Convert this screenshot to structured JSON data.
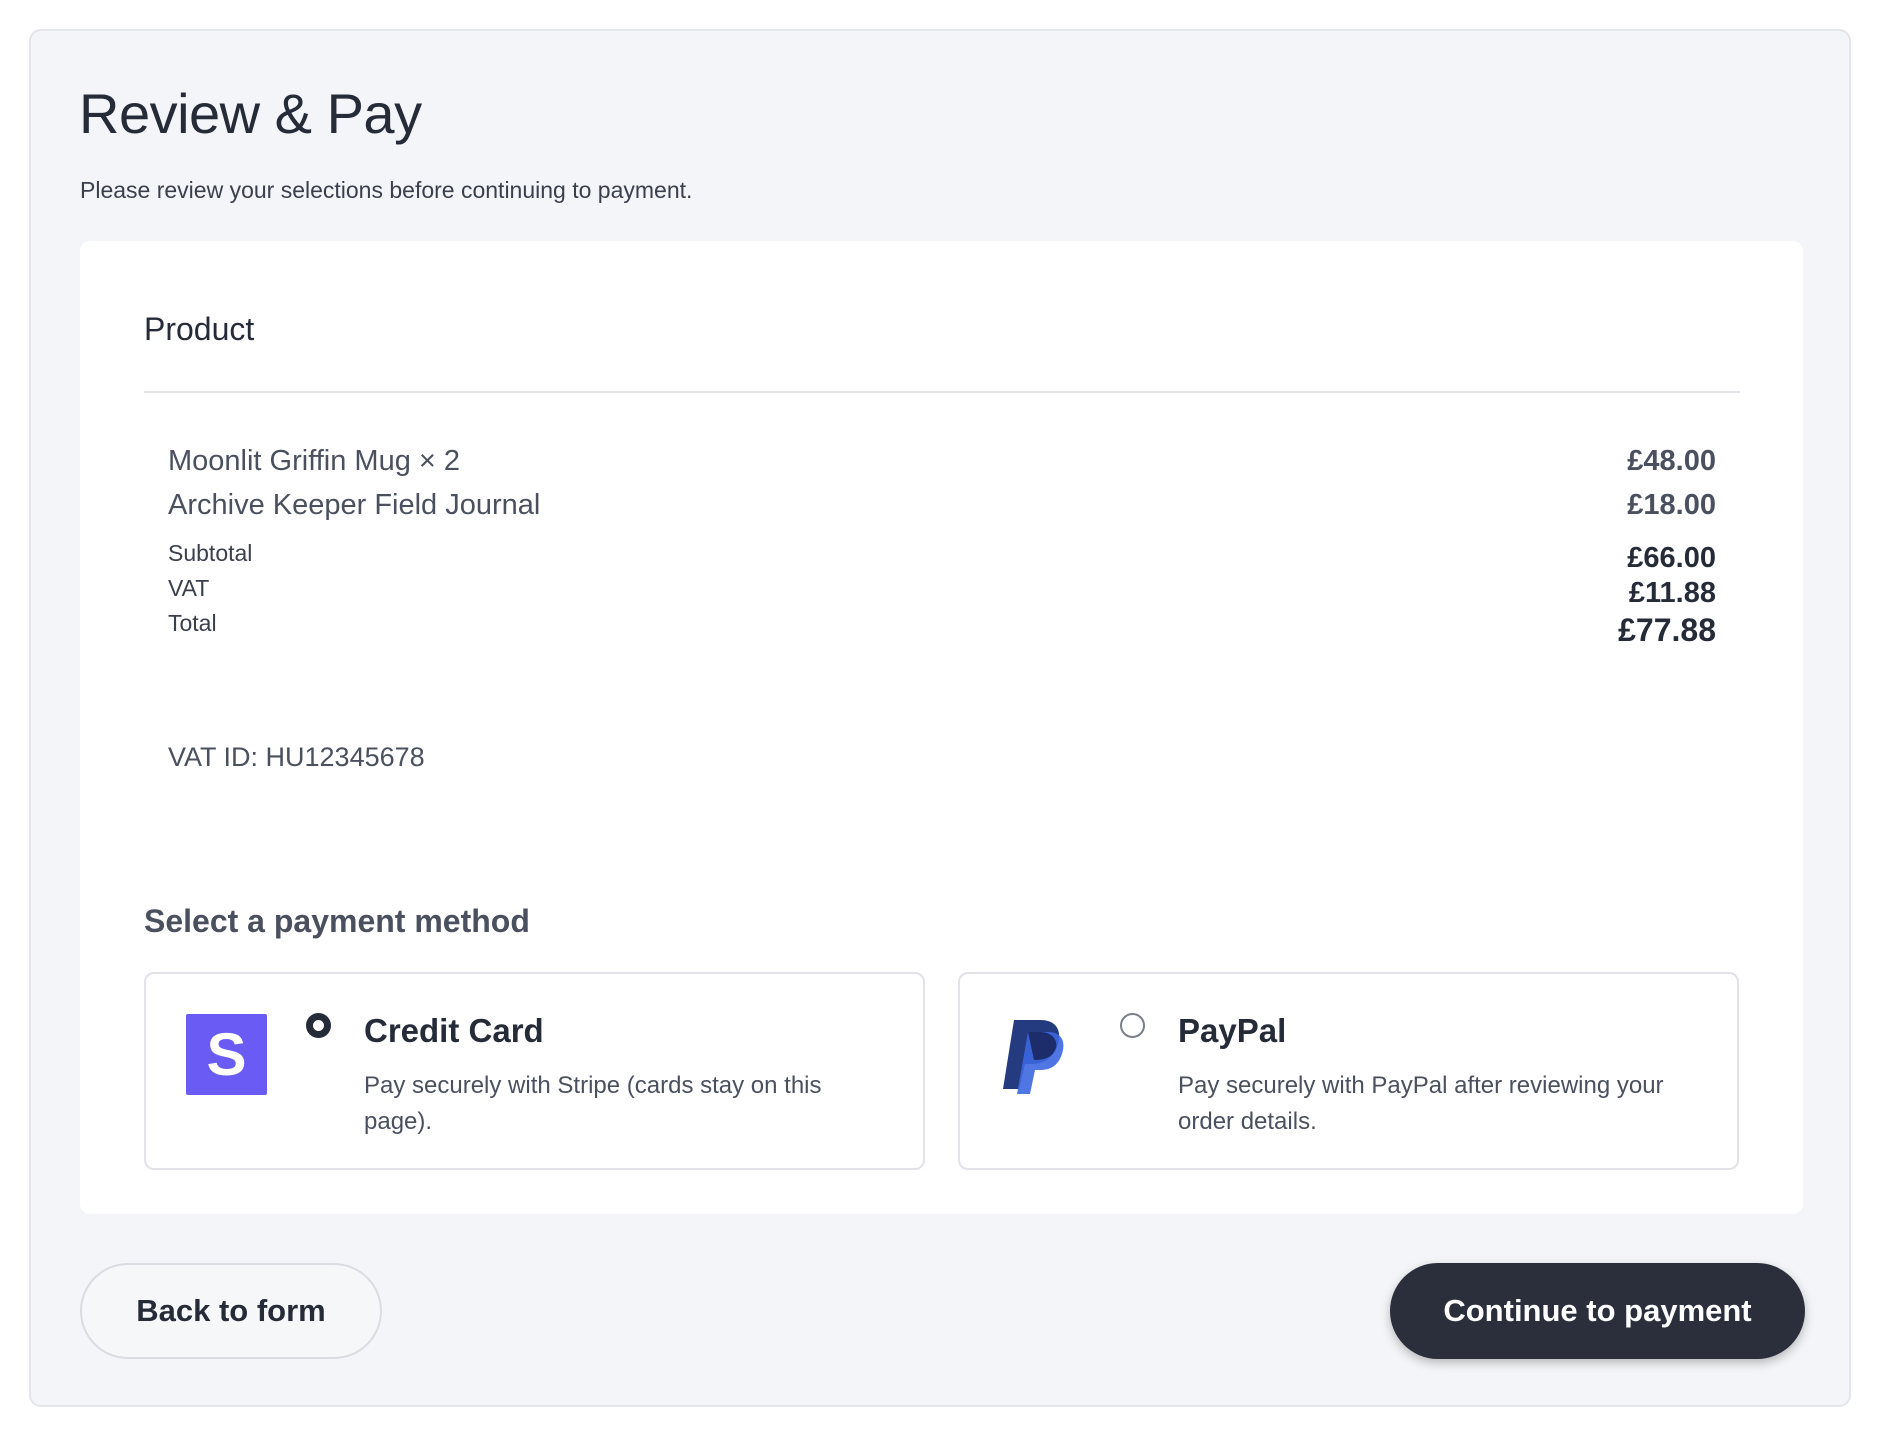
{
  "header": {
    "title": "Review & Pay",
    "subtitle": "Please review your selections before continuing to payment."
  },
  "summary": {
    "heading": "Product",
    "items": [
      {
        "name": "Moonlit Griffin Mug × 2",
        "price": "£48.00"
      },
      {
        "name": "Archive Keeper Field Journal",
        "price": "£18.00"
      }
    ],
    "subtotal_label": "Subtotal",
    "subtotal_value": "£66.00",
    "vat_label": "VAT",
    "vat_value": "£11.88",
    "total_label": "Total",
    "total_value": "£77.88",
    "vat_id": "VAT ID: HU12345678"
  },
  "payment": {
    "heading": "Select a payment method",
    "options": [
      {
        "title": "Credit Card",
        "description": "Pay securely with Stripe (cards stay on this page).",
        "logo_letter": "S",
        "selected": true
      },
      {
        "title": "PayPal",
        "description": "Pay securely with PayPal after reviewing your order details.",
        "selected": false
      }
    ]
  },
  "actions": {
    "back_label": "Back to form",
    "continue_label": "Continue to payment"
  },
  "colors": {
    "stripe": "#6a5bf5",
    "paypal_dark": "#253b80",
    "paypal_light": "#179bd7",
    "primary_button": "#2b2f3c"
  }
}
